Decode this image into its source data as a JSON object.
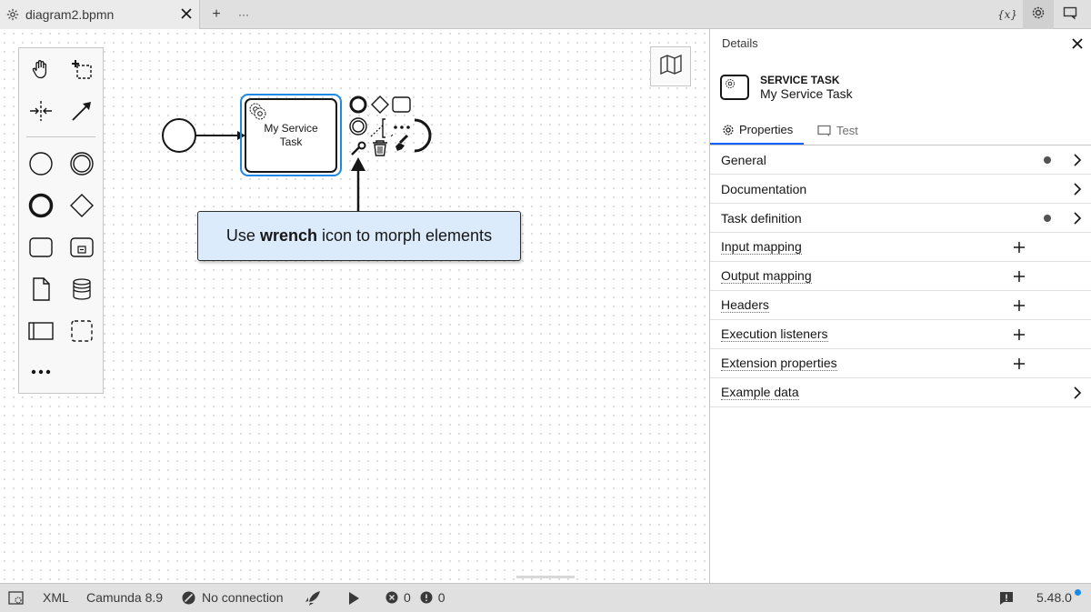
{
  "tabbar": {
    "tab_label": "diagram2.bpmn",
    "add_tab": "+",
    "more": "···",
    "variables_icon": "{x}"
  },
  "diagram": {
    "task_name_line1": "My Service",
    "task_name_line2": "Task"
  },
  "tooltip": {
    "prefix": "Use ",
    "bold": "wrench",
    "suffix": " icon to morph elements"
  },
  "panel": {
    "title": "Details",
    "element_type": "SERVICE TASK",
    "element_name": "My Service Task",
    "tabs": [
      {
        "label": "Properties",
        "icon": "gear-icon",
        "active": true
      },
      {
        "label": "Test",
        "icon": "play-screen-icon",
        "active": false
      }
    ],
    "groups": [
      {
        "label": "General",
        "indicator": "dot",
        "action": "chevron"
      },
      {
        "label": "Documentation",
        "indicator": "",
        "action": "chevron"
      },
      {
        "label": "Task definition",
        "indicator": "dot",
        "action": "chevron"
      },
      {
        "label": "Input mapping",
        "indicator": "",
        "action": "plus"
      },
      {
        "label": "Output mapping",
        "indicator": "",
        "action": "plus"
      },
      {
        "label": "Headers",
        "indicator": "",
        "action": "plus"
      },
      {
        "label": "Execution listeners",
        "indicator": "",
        "action": "plus"
      },
      {
        "label": "Extension properties",
        "indicator": "",
        "action": "plus"
      },
      {
        "label": "Example data",
        "indicator": "",
        "action": "chevron"
      }
    ]
  },
  "statusbar": {
    "xml": "XML",
    "engine": "Camunda 8.9",
    "connection": "No connection",
    "errors": "0",
    "warnings": "0",
    "version": "5.48.0"
  },
  "colors": {
    "selection": "#1e88e5",
    "tooltip_bg": "#dcebfb",
    "active_tab_underline": "#0f62fe",
    "update_dot": "#1e88e5"
  }
}
